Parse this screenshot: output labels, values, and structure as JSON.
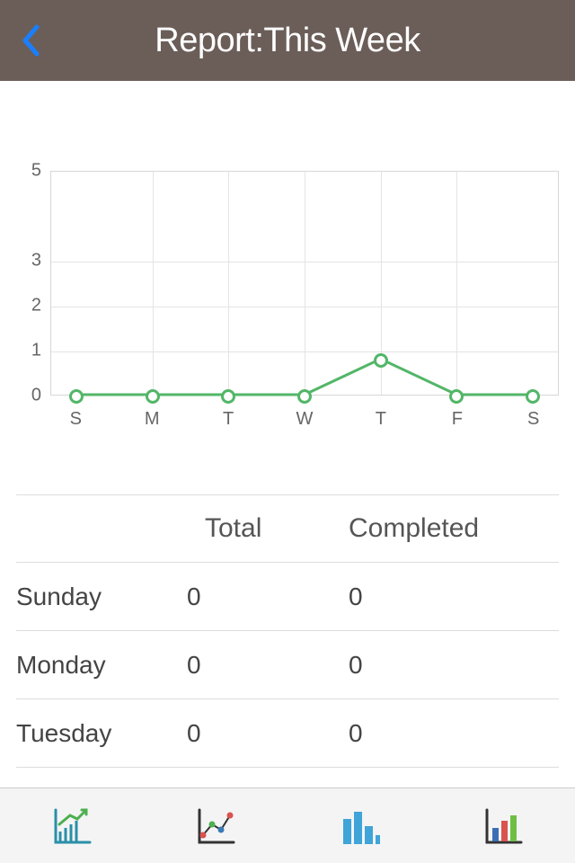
{
  "header": {
    "title": "Report:This Week"
  },
  "chart_data": {
    "type": "line",
    "categories": [
      "S",
      "M",
      "T",
      "W",
      "T",
      "F",
      "S"
    ],
    "values": [
      0,
      0,
      0,
      0,
      0.8,
      0,
      0
    ],
    "y_ticks": [
      0,
      1,
      2,
      3,
      5
    ],
    "ylim": [
      0,
      5
    ],
    "line_color": "#52b668",
    "point_fill": "#ffffff"
  },
  "table": {
    "headers": {
      "total": "Total",
      "completed": "Completed"
    },
    "rows": [
      {
        "day": "Sunday",
        "total": "0",
        "completed": "0"
      },
      {
        "day": "Monday",
        "total": "0",
        "completed": "0"
      },
      {
        "day": "Tuesday",
        "total": "0",
        "completed": "0"
      }
    ]
  },
  "tabs": [
    "line-chart-up",
    "scatter-chart",
    "bar-chart-blue",
    "bar-chart-multi"
  ]
}
